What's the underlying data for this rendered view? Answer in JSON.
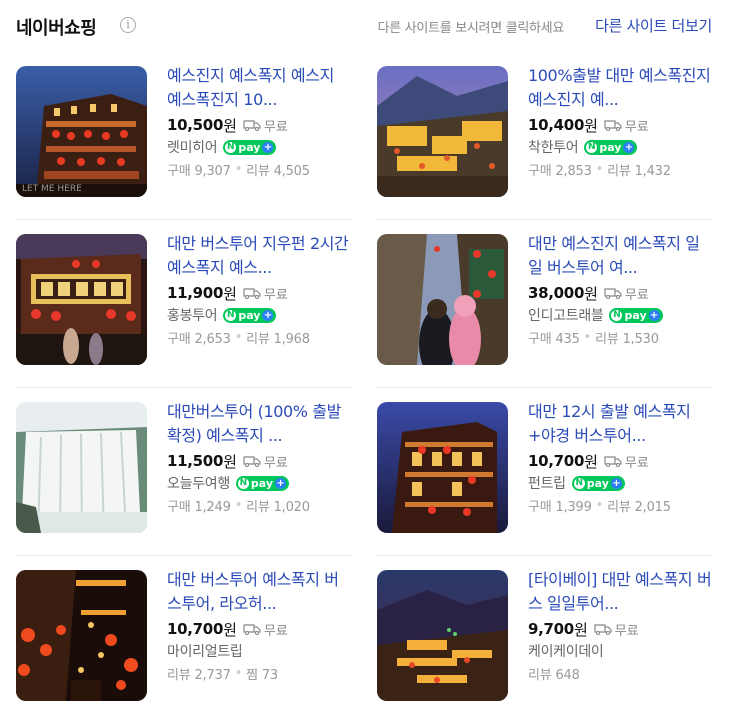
{
  "header": {
    "brand": "네이버쇼핑",
    "info_icon": "i",
    "hint": "다른 사이트를 보시려면 클릭하세요",
    "more_link": "다른 사이트 더보기"
  },
  "labels": {
    "won": "원",
    "free_shipping": "무료",
    "npay": "pay",
    "npay_plus": "+",
    "npay_n": "N"
  },
  "colors": {
    "link": "#2b4bb8",
    "npay_green": "#03c75a",
    "npay_blue": "#2b7ff6"
  },
  "products": [
    {
      "title": "예스진지 예스폭지 예스지 예스폭진지 10...",
      "price": "10,500",
      "seller": "렛미히어",
      "npay": true,
      "stat1": "구매 9,307",
      "stat2": "리뷰 4,505",
      "watermark": "LET ME HERE"
    },
    {
      "title": "100%출발 대만 예스폭진지 예스진지 예...",
      "price": "10,400",
      "seller": "착한투어",
      "npay": true,
      "stat1": "구매 2,853",
      "stat2": "리뷰 1,432"
    },
    {
      "title": "대만 버스투어 지우펀 2시간 예스폭지 예스...",
      "price": "11,900",
      "seller": "홍봉투어",
      "npay": true,
      "stat1": "구매 2,653",
      "stat2": "리뷰 1,968"
    },
    {
      "title": "대만 예스진지 예스폭지 일일 버스투어 여...",
      "price": "38,000",
      "seller": "인디고트래블",
      "npay": true,
      "stat1": "구매 435",
      "stat2": "리뷰 1,530"
    },
    {
      "title": "대만버스투어 (100% 출발확정) 예스폭지 ...",
      "price": "11,500",
      "seller": "오늘두여행",
      "npay": true,
      "stat1": "구매 1,249",
      "stat2": "리뷰 1,020"
    },
    {
      "title": "대만 12시 출발 예스폭지+야경 버스투어...",
      "price": "10,700",
      "seller": "펀트립",
      "npay": true,
      "stat1": "구매 1,399",
      "stat2": "리뷰 2,015"
    },
    {
      "title": "대만 버스투어 예스폭지 버스투어, 라오허...",
      "price": "10,700",
      "seller": "마이리얼트립",
      "npay": false,
      "stat1": "리뷰 2,737",
      "stat2": "찜 73"
    },
    {
      "title": "[타이베이] 대만 예스폭지 버스 일일투어...",
      "price": "9,700",
      "seller": "케이케이데이",
      "npay": false,
      "stat1": "리뷰 648",
      "stat2": ""
    }
  ]
}
